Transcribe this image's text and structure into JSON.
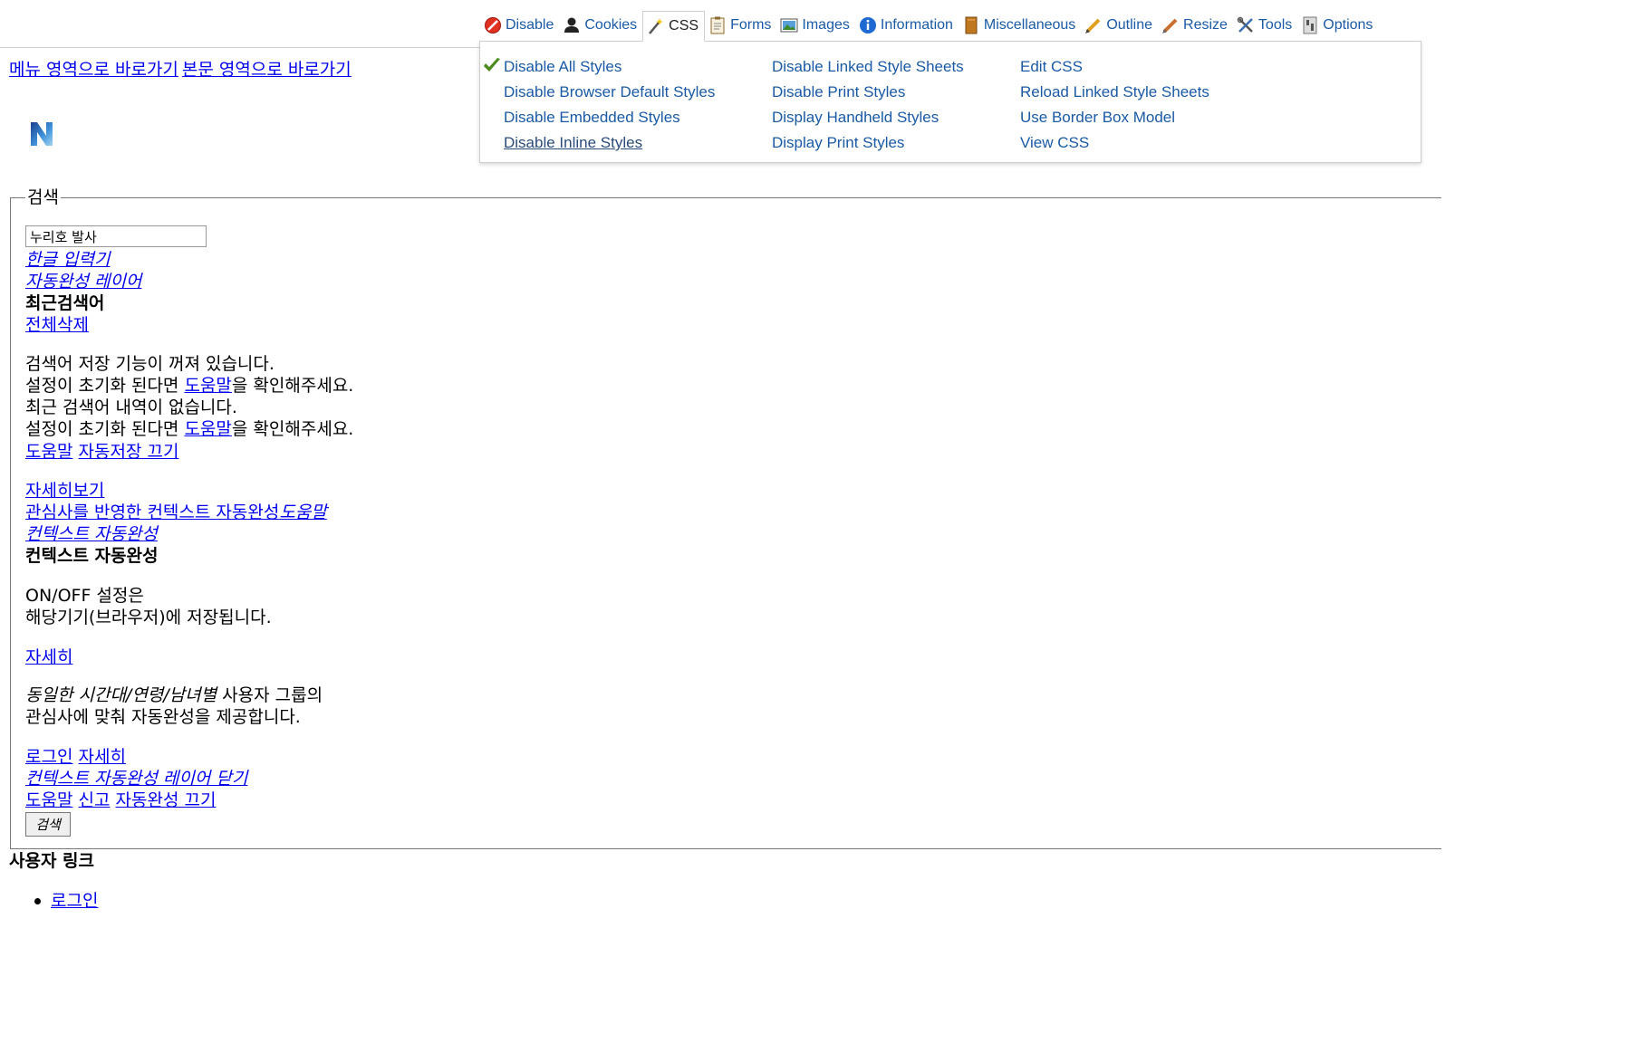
{
  "toolbar": {
    "items": [
      {
        "label": "Disable",
        "icon": "disable-icon"
      },
      {
        "label": "Cookies",
        "icon": "cookies-icon"
      },
      {
        "label": "CSS",
        "icon": "css-wand-icon"
      },
      {
        "label": "Forms",
        "icon": "forms-icon"
      },
      {
        "label": "Images",
        "icon": "images-icon"
      },
      {
        "label": "Information",
        "icon": "information-icon"
      },
      {
        "label": "Miscellaneous",
        "icon": "miscellaneous-icon"
      },
      {
        "label": "Outline",
        "icon": "outline-icon"
      },
      {
        "label": "Resize",
        "icon": "resize-icon"
      },
      {
        "label": "Tools",
        "icon": "tools-icon"
      },
      {
        "label": "Options",
        "icon": "options-icon"
      }
    ],
    "active": "CSS"
  },
  "css_menu": {
    "col1": [
      "Disable All Styles",
      "Disable Browser Default Styles",
      "Disable Embedded Styles",
      "Disable Inline Styles"
    ],
    "col2": [
      "Disable Linked Style Sheets",
      "Disable Print Styles",
      "Display Handheld Styles",
      "Display Print Styles"
    ],
    "col3": [
      "Edit CSS",
      "Reload Linked Style Sheets",
      "Use Border Box Model",
      "View CSS"
    ],
    "checked": "Disable All Styles",
    "hovered": "Disable Inline Styles"
  },
  "skip_links": [
    "메뉴 영역으로 바로가기",
    "본문 영역으로 바로가기"
  ],
  "search": {
    "legend": "검색",
    "query": "누리호 발사",
    "korean_ime": "한글 입력기",
    "autocomplete_layer": "자동완성 레이어",
    "recent_title": "최근검색어",
    "delete_all": "전체삭제",
    "save_off_text": "검색어 저장 기능이 꺼져 있습니다.",
    "reset_prefix": "설정이 초기화 된다면 ",
    "help": "도움말",
    "reset_suffix": "을 확인해주세요.",
    "no_recent_text": "최근 검색어 내역이 없습니다.",
    "autosave_off": "자동저장 끄기",
    "details_view": "자세히보기",
    "interest_context": "관심사를 반영한 컨텍스트 자동완성",
    "context_ac": "컨텍스트 자동완성",
    "onoff_line1": "ON/OFF 설정은",
    "onoff_line2": "해당기기(브라우저)에 저장됩니다.",
    "details": "자세히",
    "group_italic": "동일한 시간대/연령/남녀별",
    "group_rest": " 사용자 그룹의",
    "group_line2": "관심사에 맞춰 자동완성을 제공합니다.",
    "login": "로그인",
    "close_context_layer": "컨텍스트 자동완성 레이어 닫기",
    "report": "신고",
    "autocomplete_off": "자동완성 끄기",
    "button": "검색"
  },
  "user_links": {
    "title": "사용자 링크",
    "items": [
      "로그인"
    ]
  },
  "colors": {
    "link": "#0000ee",
    "toolbar_link": "#1a5aa6",
    "check": "#4a8a1c"
  }
}
